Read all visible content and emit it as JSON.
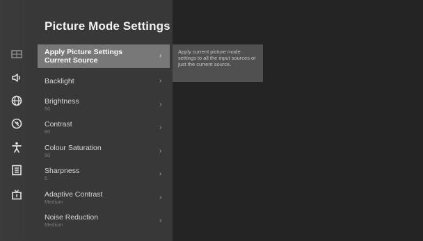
{
  "panel": {
    "title": "Picture Mode Settings"
  },
  "sidebar": {
    "icons": [
      {
        "name": "picture-icon",
        "active": true
      },
      {
        "name": "sound-icon"
      },
      {
        "name": "network-icon"
      },
      {
        "name": "general-settings-icon"
      },
      {
        "name": "accessibility-icon"
      },
      {
        "name": "system-info-icon"
      },
      {
        "name": "channel-icon"
      }
    ]
  },
  "menu": {
    "items": [
      {
        "label": "Apply Picture Settings\nCurrent Source",
        "value": "",
        "focused": true
      },
      {
        "label": "Backlight",
        "value": ""
      },
      {
        "label": "Brightness",
        "value": "50"
      },
      {
        "label": "Contrast",
        "value": "80"
      },
      {
        "label": "Colour Saturation",
        "value": "50"
      },
      {
        "label": "Sharpness",
        "value": "5"
      },
      {
        "label": "Adaptive Contrast",
        "value": "Medium"
      },
      {
        "label": "Noise Reduction",
        "value": "Medium"
      }
    ]
  },
  "description": {
    "text": "Apply current picture mode settings to all the input sources or just the current source."
  },
  "colors": {
    "background": "#242424",
    "panel": "#383838",
    "focus": "#787878",
    "description_box": "#505050"
  }
}
